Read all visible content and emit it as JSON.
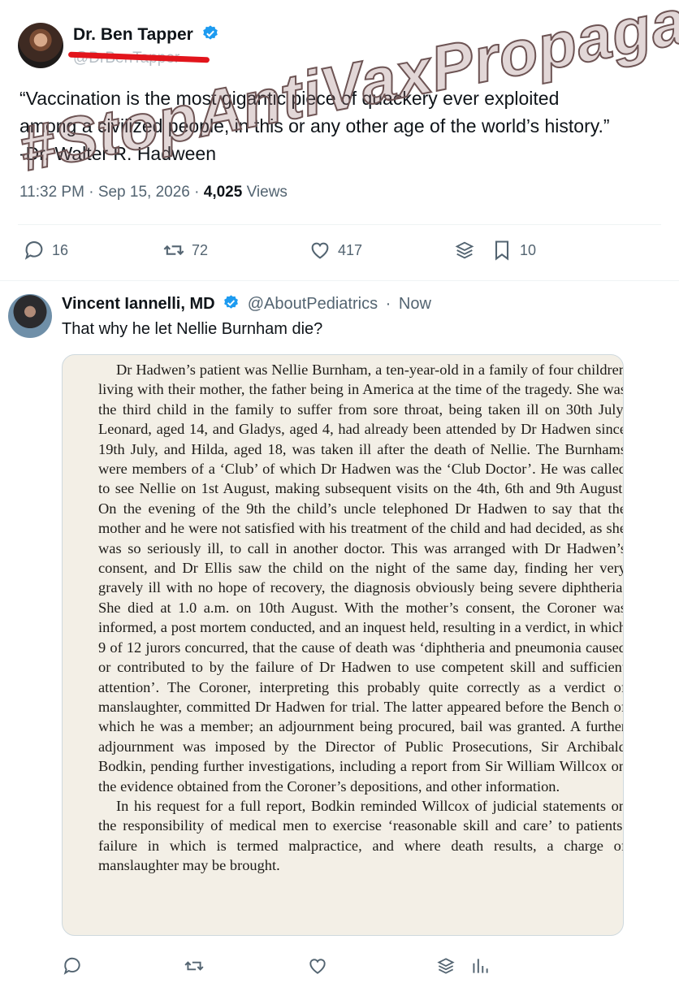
{
  "quoted": {
    "name": "Dr. Ben Tapper",
    "handle": "@DrBenTapper",
    "text": "“Vaccination is the most gigantic piece of quackery ever exploited\namong a civilized people, in this or any other age of the world’s history.”\n-Dr. Walter R. Hadween",
    "time": "11:32 PM",
    "date": "Sep 15, 2026",
    "views": "4,025",
    "views_label": "Views",
    "replies": "16",
    "retweets": "72",
    "likes": "417",
    "bookmarks": "10"
  },
  "watermark": "#StopAntiVaxPropaganda",
  "reply": {
    "name": "Vincent Iannelli, MD",
    "handle": "@AboutPediatrics",
    "time": "Now",
    "text": "That why he let Nellie Burnham die?"
  },
  "page_text": {
    "p1": "Dr Hadwen’s patient was Nellie Burnham, a ten-year-old in a family of four children living with their mother, the father being in America at the time of the tragedy. She was the third child in the family to suffer from sore throat, being taken ill on 30th July. Leonard, aged 14, and Gladys, aged 4, had already been attended by Dr Hadwen since 19th July, and Hilda, aged 18, was taken ill after the death of Nellie. The Burnhams were members of a ‘Club’ of which Dr Hadwen was the ‘Club Doctor’. He was called to see Nellie on 1st August, making subsequent visits on the 4th, 6th and 9th August. On the evening of the 9th the child’s uncle telephoned Dr Hadwen to say that the mother and he were not satisfied with his treatment of the child and had decided, as she was so seriously ill, to call in another doctor. This was arranged with Dr Hadwen’s consent, and Dr Ellis saw the child on the night of the same day, finding her very gravely ill with no hope of recovery, the diagnosis obviously being severe diphtheria. She died at 1.0 a.m. on 10th August. With the mother’s consent, the Coroner was informed, a post mortem conducted, and an inquest held, resulting in a verdict, in which 9 of 12 jurors concurred, that the cause of death was ‘diphtheria and pneumonia caused or contributed to by the failure of Dr Hadwen to use competent skill and sufficient attention’. The Coroner, interpreting this probably quite correctly as a verdict of manslaughter, committed Dr Hadwen for trial. The latter appeared before the Bench of which he was a member; an adjournment being procured, bail was granted. A further adjournment was imposed by the Director of Public Prosecutions, Sir Archibald Bodkin, pending further investigations, including a report from Sir William Willcox on the evidence obtained from the Coroner’s depositions, and other information.",
    "p2": "In his request for a full report, Bodkin reminded Willcox of judicial statements on the responsibility of medical men to exercise ‘reasonable skill and care’ to patients, failure in which is termed malpractice, and where death results, a charge of manslaughter may be brought."
  },
  "colors": {
    "verified": "#1d9bf0",
    "muted": "#536471",
    "red_underline": "#e2151c",
    "paper": "#f3efe6"
  },
  "icons": [
    "reply-icon",
    "retweet-icon",
    "like-icon",
    "grok-icon",
    "bookmark-icon",
    "views-icon",
    "verified-badge-icon"
  ]
}
